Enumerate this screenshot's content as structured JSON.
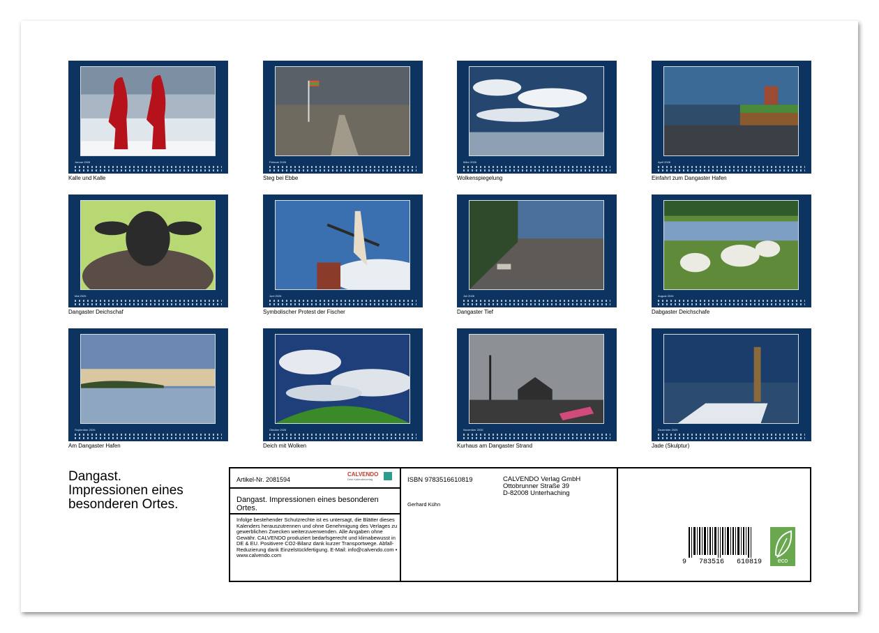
{
  "cards": [
    {
      "month": "Januar 2026",
      "caption": "Kalle und Kalle"
    },
    {
      "month": "Februar 2026",
      "caption": "Steg bei Ebbe"
    },
    {
      "month": "März 2026",
      "caption": "Wolkenspiegelung"
    },
    {
      "month": "April 2026",
      "caption": "Einfahrt zum Dangaster Hafen"
    },
    {
      "month": "Mai 2026",
      "caption": "Dangaster Deichschaf"
    },
    {
      "month": "Juni 2026",
      "caption": "Symbolischer Protest der Fischer"
    },
    {
      "month": "Juli 2026",
      "caption": "Dangaster Tief"
    },
    {
      "month": "August 2026",
      "caption": "Dabgaster Deichschafe"
    },
    {
      "month": "September 2026",
      "caption": "Am Dangaster Hafen"
    },
    {
      "month": "Oktober 2026",
      "caption": "Deich mit Wolken"
    },
    {
      "month": "November 2026",
      "caption": "Kurhaus am Dangaster Strand"
    },
    {
      "month": "Dezember 2026",
      "caption": "Jade (Skulptur)"
    }
  ],
  "title_lines": [
    "Dangast.",
    "Impressionen eines",
    "besonderen Ortes."
  ],
  "info": {
    "article": "Artikel-Nr. 2081594",
    "calvendo_logo": "CALVENDO",
    "calvendo_sub": "Dein Kalenderverlag",
    "title": "Dangast. Impressionen eines besonderen Ortes.",
    "legal": "Infolge bestehender Schutzrechte ist es untersagt, die Blätter dieses Kalenders herauszutrennen und ohne Genehmigung des Verlages zu gewerblichen Zwecken weiterzuverwenden. Alle Angaben ohne Gewähr. CALVENDO produziert bedarfsgerecht und klimabewusst in DE & EU. Positivere CO2-Bilanz dank kurzer Transportwege. Abfall-Reduzierung dank Einzelstückfertigung. E-Mail: info@calvendo.com • www.calvendo.com",
    "isbn": "ISBN 9783516610819",
    "author": "Gerhard Kühn",
    "publisher_lines": [
      "CALVENDO Verlag GmbH",
      "Ottobrunner Straße 39",
      "D-82008 Unterhaching"
    ],
    "barcode_digits": "9   783516   610819",
    "eco_label": "eco"
  }
}
